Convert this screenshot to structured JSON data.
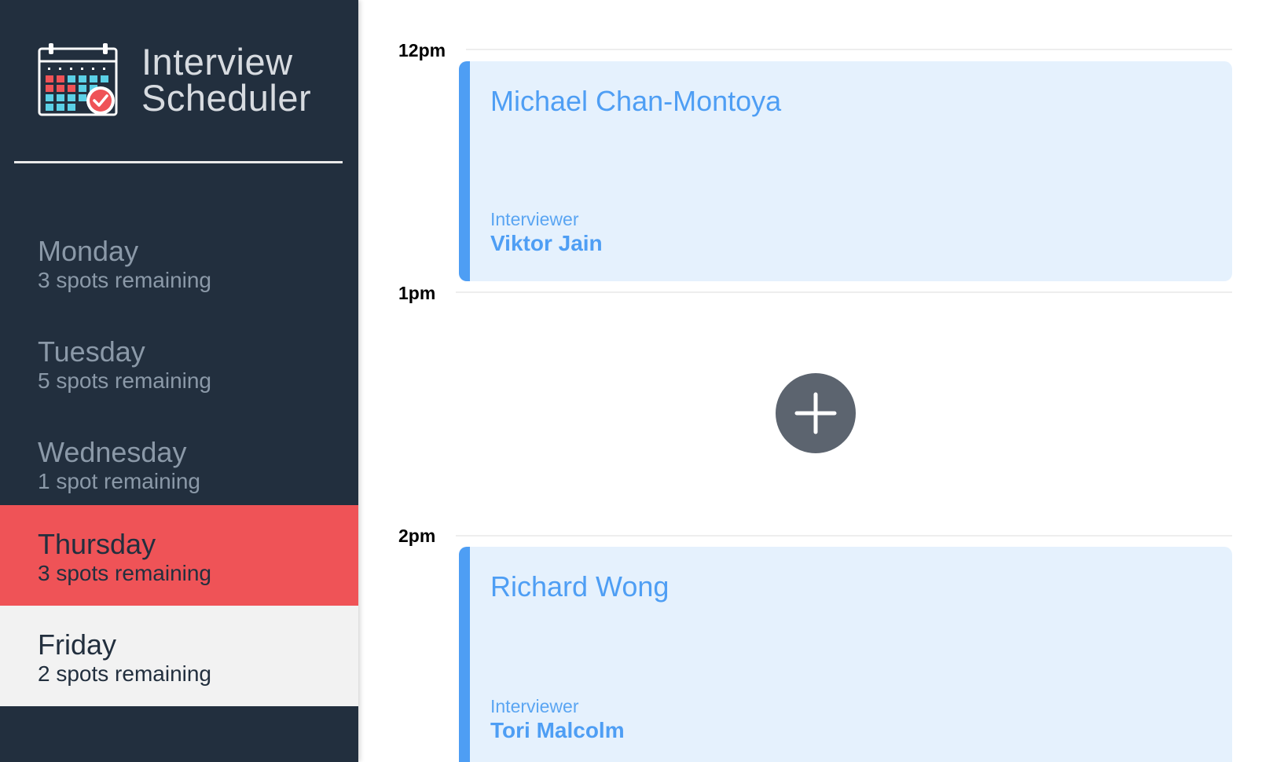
{
  "app": {
    "title_line1": "Interview",
    "title_line2": "Scheduler"
  },
  "days": [
    {
      "name": "Monday",
      "spots": "3 spots remaining"
    },
    {
      "name": "Tuesday",
      "spots": "5 spots remaining"
    },
    {
      "name": "Wednesday",
      "spots": "1 spot remaining"
    },
    {
      "name": "Thursday",
      "spots": "3 spots remaining"
    },
    {
      "name": "Friday",
      "spots": "2 spots remaining"
    }
  ],
  "schedule": {
    "times": [
      "12pm",
      "1pm",
      "2pm"
    ],
    "appointments": [
      {
        "student": "Michael Chan-Montoya",
        "interviewer_label": "Interviewer",
        "interviewer": "Viktor Jain"
      },
      {
        "student": "Richard Wong",
        "interviewer_label": "Interviewer",
        "interviewer": "Tori Malcolm"
      }
    ]
  },
  "colors": {
    "sidebar_bg": "#222f3e",
    "selected_day": "#ef5357",
    "accent_blue": "#4e9ef4",
    "appointment_bg": "#e5f1fd",
    "add_button": "#5c646f"
  },
  "icons": {
    "logo": "calendar-check-icon",
    "add": "plus-icon"
  }
}
